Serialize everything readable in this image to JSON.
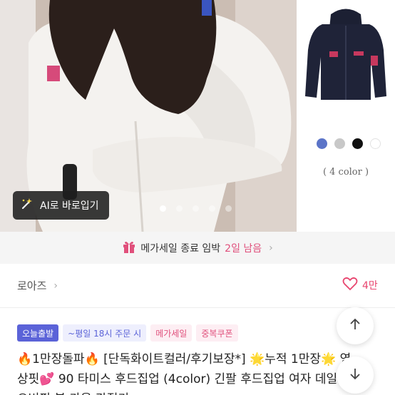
{
  "gallery": {
    "ai_button_label": "AI로 바로입기",
    "color_count": "( 4 color )",
    "swatches": [
      "#5b74c8",
      "#c8c8c8",
      "#111111",
      "#ffffff"
    ],
    "active_dot": 0,
    "dot_count": 5
  },
  "sale_banner": {
    "text": "메가세일 종료 임박",
    "remaining": "2일 남음",
    "accent_color": "#e0507c"
  },
  "store": {
    "name": "로아즈",
    "like_count": "4만"
  },
  "badges": {
    "today": "오늘출발",
    "delivery": "~평일 18시 주문 시",
    "mega": "메가세일",
    "coupon": "중복쿠폰"
  },
  "product": {
    "title": "🔥1만장돌파🔥 [단독화이트컬러/후기보장*] 🌟누적 1만장🌟 영상핏💕 90 타미스 후드집업 (4color) 긴팔 후드집업 여자 데일리 오버핏 봄 가을 간절기"
  }
}
